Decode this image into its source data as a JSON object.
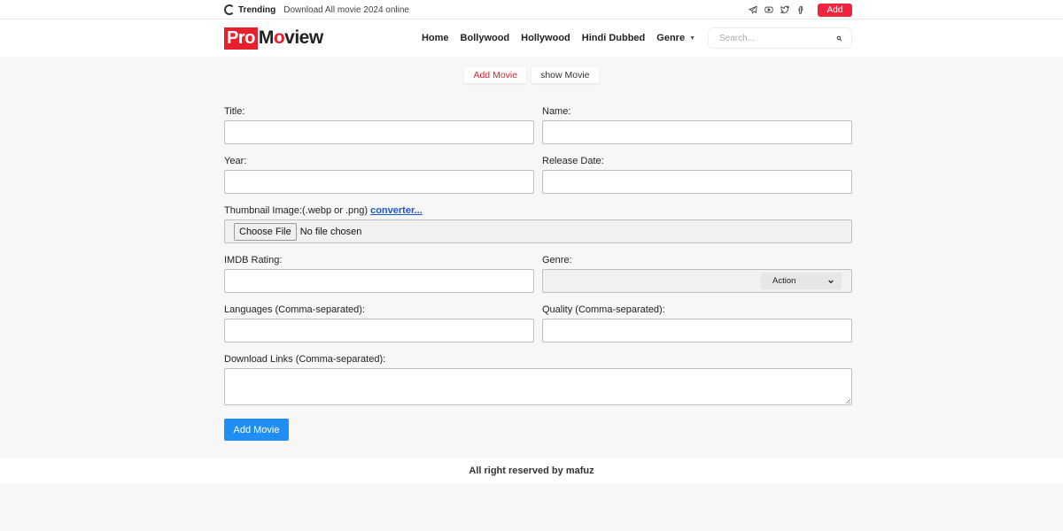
{
  "topbar": {
    "trending_label": "Trending",
    "trending_text": "Download All movie 2024 online",
    "social_icons": [
      "telegram-icon",
      "youtube-icon",
      "twitter-icon",
      "facebook-icon"
    ],
    "add_label": "Add",
    "add_color": "#f0243d"
  },
  "header": {
    "logo_pro": "Pro",
    "logo_m": "M",
    "logo_o": "o",
    "logo_rest": "view",
    "nav": {
      "home": "Home",
      "bollywood": "Bollywood",
      "hollywood": "Hollywood",
      "hindi_dubbed": "Hindi Dubbed",
      "genre": "Genre"
    },
    "search_placeholder": "Search..."
  },
  "tabs": {
    "add_movie": "Add Movie",
    "show_movie": "show Movie"
  },
  "form": {
    "title_label": "Title:",
    "name_label": "Name:",
    "year_label": "Year:",
    "release_date_label": "Release Date:",
    "thumbnail_label": "Thumbnail Image:(.webp or .png)",
    "converter_link": "converter...",
    "choose_file": "Choose File",
    "no_file": "No file chosen",
    "imdb_label": "IMDB Rating:",
    "genre_label": "Genre:",
    "genre_selected": "Action",
    "languages_label": "Languages (Comma-separated):",
    "quality_label": "Quality (Comma-separated):",
    "download_label": "Download Links (Comma-separated):",
    "submit_label": "Add Movie",
    "submit_color": "#1f8ef5"
  },
  "footer": {
    "text": "All right reserved by mafuz"
  },
  "colors": {
    "brand_red": "#e8202e",
    "link_blue": "#1a55d6"
  }
}
